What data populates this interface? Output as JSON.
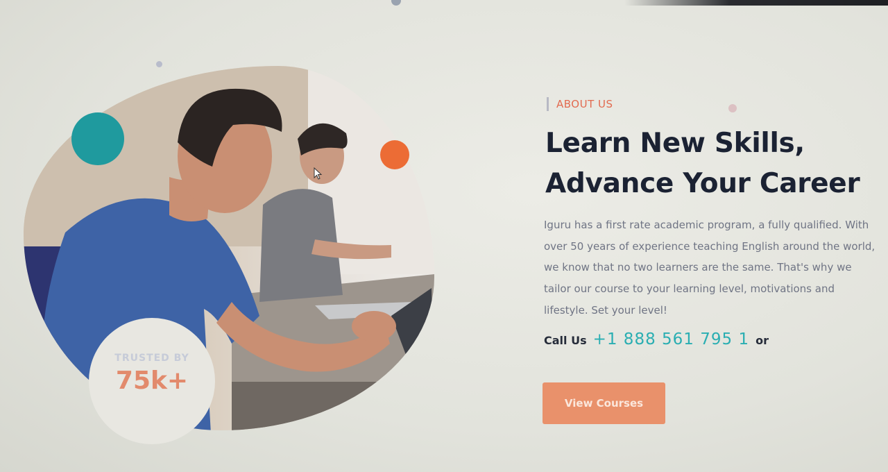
{
  "hero_image": {
    "alt": "",
    "colors": {
      "shirt": "#3e63a6",
      "skin": "#c98f73",
      "hair": "#2b2422",
      "desk": "#9b938c"
    }
  },
  "accents": {
    "teal": "#1f9a9e",
    "orange": "#ec6c35",
    "button": "#e9916b"
  },
  "badge": {
    "label": "TRUSTED BY",
    "value": "75k+"
  },
  "section_tag": "ABOUT US",
  "headline": {
    "line1": "Learn New Skills,",
    "line2": "Advance Your Career"
  },
  "description_lines": [
    "Iguru has a first rate academic program, a fully qualified. With",
    "over 50 years of experience teaching English around the world,",
    "we know that no two learners are the same. That's why we",
    "tailor our course to your learning level, motivations and",
    "lifestyle. Set your level!"
  ],
  "call": {
    "label": "Call Us",
    "phone": "+1 888 561 795 1",
    "or": "or"
  },
  "cta": {
    "label": "View Courses"
  },
  "icons": {
    "cursor": "mouse-pointer-icon"
  }
}
